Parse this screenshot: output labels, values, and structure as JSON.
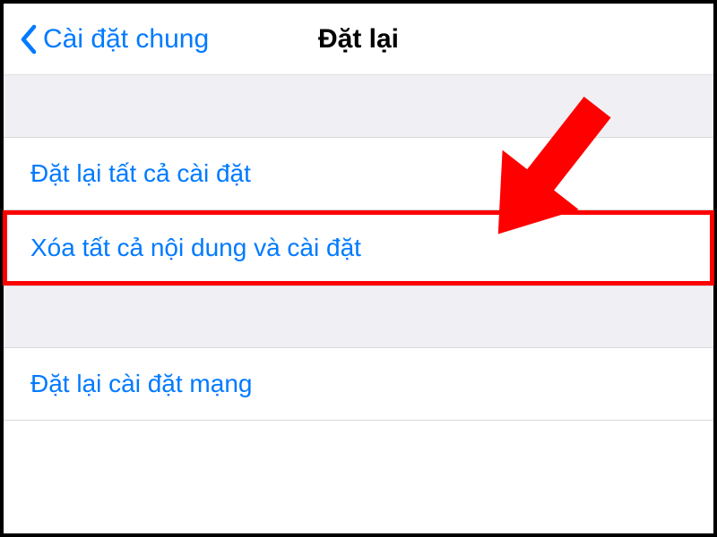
{
  "header": {
    "back_label": "Cài đặt chung",
    "title": "Đặt lại"
  },
  "items": [
    {
      "label": "Đặt lại tất cả cài đặt",
      "highlighted": false
    },
    {
      "label": "Xóa tất cả nội dung và cài đặt",
      "highlighted": true
    },
    {
      "label": "Đặt lại cài đặt mạng",
      "highlighted": false
    }
  ],
  "colors": {
    "link": "#007aff",
    "highlight": "#ff0000"
  }
}
